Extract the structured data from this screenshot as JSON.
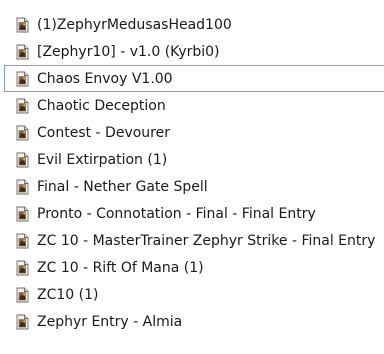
{
  "file_list": {
    "items": [
      {
        "name": "(1)ZephyrMedusasHead100",
        "icon": "map-file-icon",
        "selected": false
      },
      {
        "name": "[Zephyr10] - v1.0 (Kyrbi0)",
        "icon": "map-file-icon",
        "selected": false
      },
      {
        "name": "Chaos Envoy V1.00",
        "icon": "map-file-icon",
        "selected": true
      },
      {
        "name": "Chaotic Deception",
        "icon": "map-file-icon",
        "selected": false
      },
      {
        "name": "Contest - Devourer",
        "icon": "map-file-icon",
        "selected": false
      },
      {
        "name": "Evil Extirpation (1)",
        "icon": "map-file-icon",
        "selected": false
      },
      {
        "name": "Final - Nether Gate Spell",
        "icon": "map-file-icon",
        "selected": false
      },
      {
        "name": "Pronto - Connotation - Final - Final Entry",
        "icon": "map-file-icon",
        "selected": false
      },
      {
        "name": "ZC 10 - MasterTrainer Zephyr Strike - Final Entry",
        "icon": "map-file-icon",
        "selected": false
      },
      {
        "name": "ZC 10 - Rift Of Mana (1)",
        "icon": "map-file-icon",
        "selected": false
      },
      {
        "name": "ZC10 (1)",
        "icon": "map-file-icon",
        "selected": false
      },
      {
        "name": "Zephyr Entry - Almia",
        "icon": "map-file-icon",
        "selected": false
      }
    ]
  },
  "colors": {
    "selection_border": "#7da2ce",
    "text": "#1a1a1a"
  }
}
